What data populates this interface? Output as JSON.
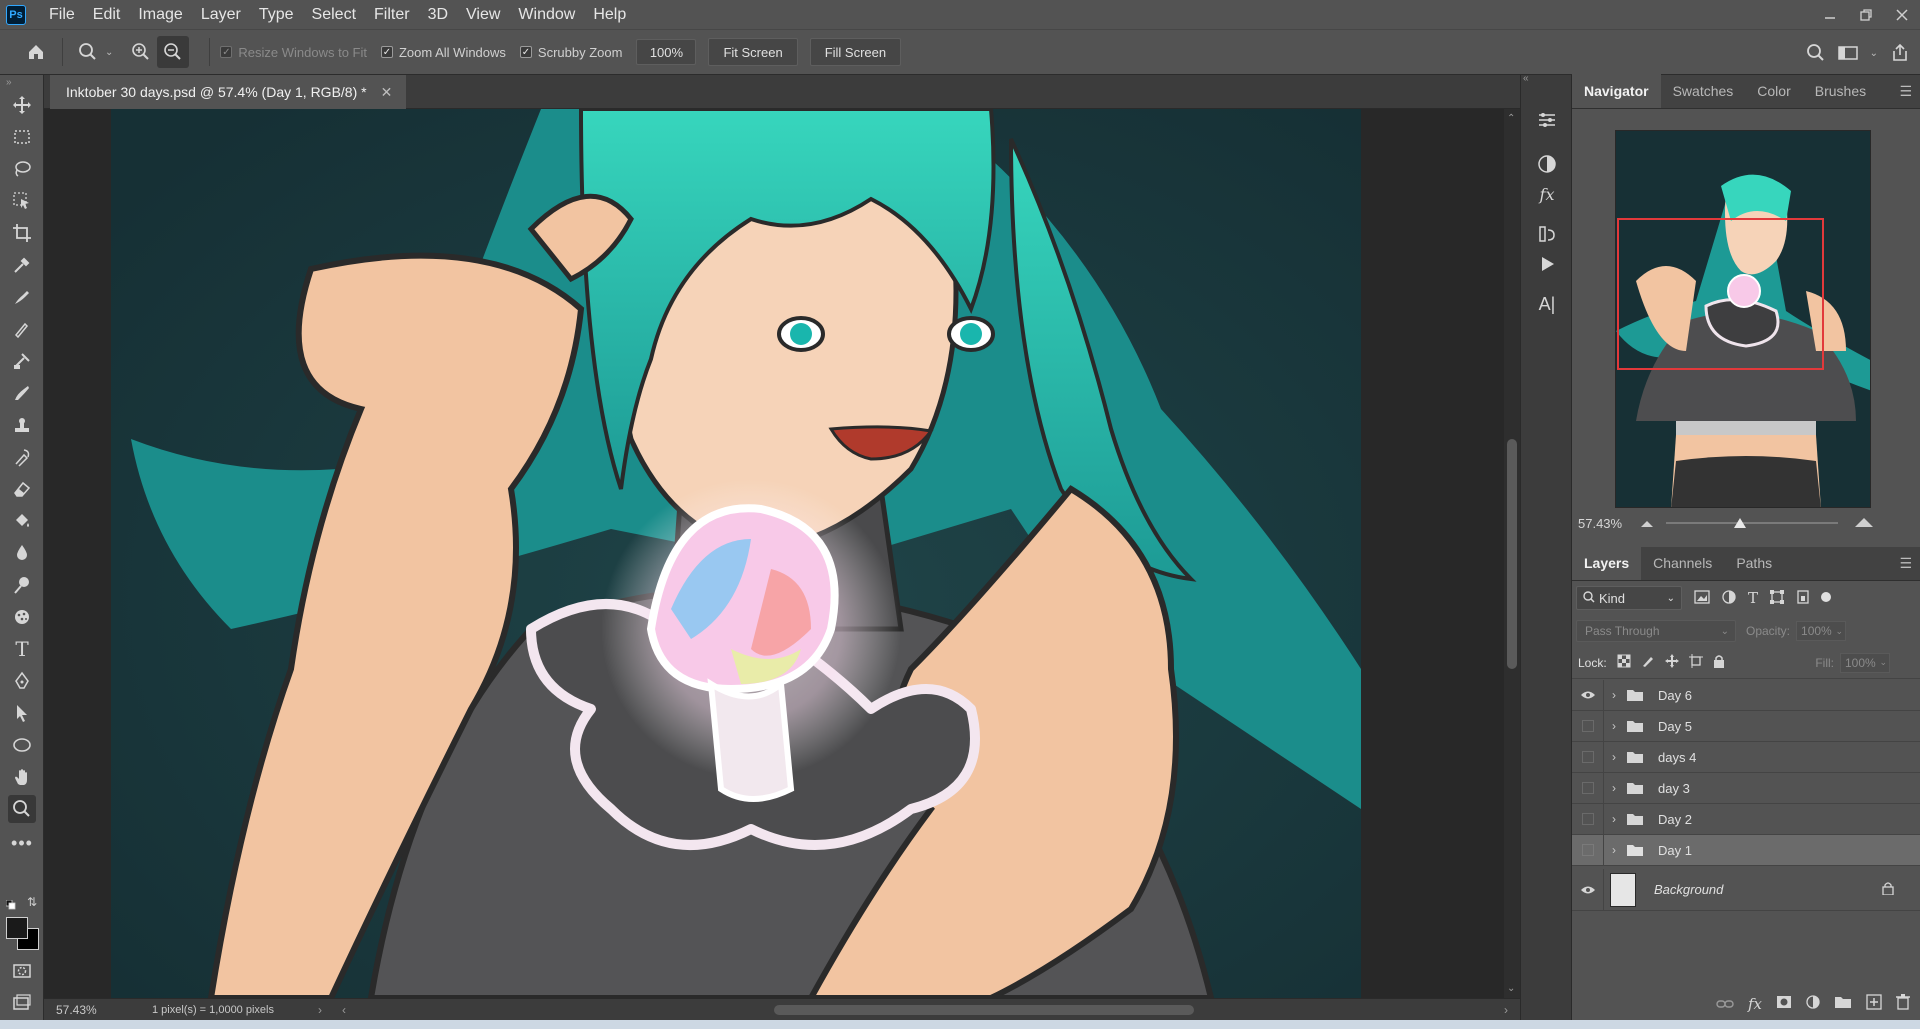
{
  "app": {
    "logo": "Ps"
  },
  "menu": [
    "File",
    "Edit",
    "Image",
    "Layer",
    "Type",
    "Select",
    "Filter",
    "3D",
    "View",
    "Window",
    "Help"
  ],
  "options": {
    "resize_windows": "Resize Windows to Fit",
    "zoom_all": "Zoom All Windows",
    "scrubby_zoom": "Scrubby Zoom",
    "zoom_value": "100%",
    "fit_screen": "Fit Screen",
    "fill_screen": "Fill Screen"
  },
  "document": {
    "tab_title": "Inktober 30 days.psd @ 57.4% (Day 1, RGB/8) *",
    "zoom": "57.43%",
    "status": "1 pixel(s) = 1,0000 pixels"
  },
  "navigator": {
    "tabs": [
      "Navigator",
      "Swatches",
      "Color",
      "Brushes"
    ],
    "zoom": "57.43%",
    "slider_fraction": 0.43
  },
  "layers": {
    "tabs": [
      "Layers",
      "Channels",
      "Paths"
    ],
    "filter_kind": "Kind",
    "blend_mode": "Pass Through",
    "opacity_label": "Opacity:",
    "opacity_value": "100%",
    "lock_label": "Lock:",
    "fill_label": "Fill:",
    "fill_value": "100%",
    "items": [
      {
        "name": "Day 6",
        "visible": true
      },
      {
        "name": "Day 5",
        "visible": false
      },
      {
        "name": "days 4",
        "visible": false
      },
      {
        "name": "day 3",
        "visible": false
      },
      {
        "name": "Day 2",
        "visible": false
      },
      {
        "name": "Day 1",
        "visible": false,
        "selected": true
      }
    ],
    "background": "Background"
  },
  "colors": {
    "accent_red": "#e2393b",
    "hair_teal": "#2ec8b0",
    "bg_dark_teal": "#173035"
  }
}
